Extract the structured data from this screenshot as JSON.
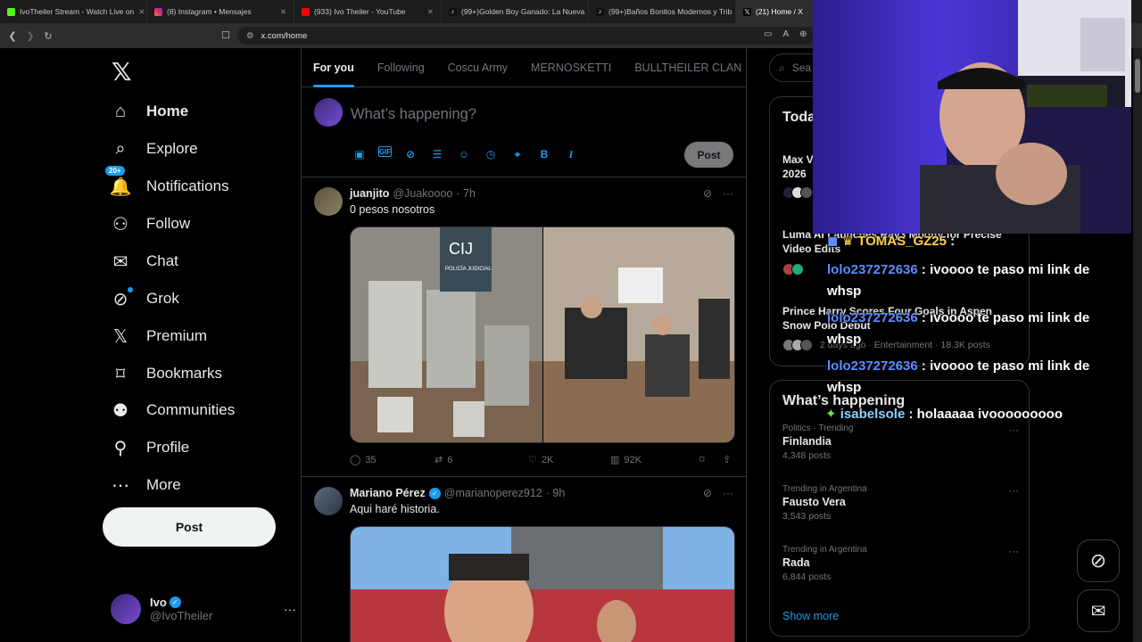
{
  "browser": {
    "tabs": [
      {
        "label": "IvoTheiler Stream - Watch Live on",
        "color": "#53fc18"
      },
      {
        "label": "(8) Instagram • Mensajes",
        "color": "#e1306c"
      },
      {
        "label": "(933) Ivo Theiler - YouTube",
        "color": "#ff0000"
      },
      {
        "label": "(99+)Golden Boy Ganado: La Nueva",
        "color": "#222222"
      },
      {
        "label": "(99+)Baños Bonitos Modernos y Trib",
        "color": "#222222"
      },
      {
        "label": "(21) Home / X",
        "color": "#000000"
      }
    ],
    "url": "x.com/home"
  },
  "sidebar": {
    "items": [
      {
        "label": "Home",
        "icon": "home-icon"
      },
      {
        "label": "Explore",
        "icon": "search-icon"
      },
      {
        "label": "Notifications",
        "icon": "bell-icon",
        "badge": "20+"
      },
      {
        "label": "Follow",
        "icon": "add-user-icon"
      },
      {
        "label": "Chat",
        "icon": "mail-icon"
      },
      {
        "label": "Grok",
        "icon": "grok-icon"
      },
      {
        "label": "Premium",
        "icon": "x-logo-icon"
      },
      {
        "label": "Bookmarks",
        "icon": "bookmark-icon"
      },
      {
        "label": "Communities",
        "icon": "communities-icon"
      },
      {
        "label": "Profile",
        "icon": "profile-icon"
      },
      {
        "label": "More",
        "icon": "more-circle-icon"
      }
    ],
    "post_label": "Post",
    "account": {
      "name": "Ivo",
      "handle": "@IvoTheiler"
    }
  },
  "feed_tabs": [
    "For you",
    "Following",
    "Coscu Army",
    "MERNOSKETTI",
    "BULLTHEILER CLAN"
  ],
  "composer": {
    "placeholder": "What’s happening?",
    "post_label": "Post"
  },
  "tweets": [
    {
      "name": "juanjito",
      "handle": "@Juakoooo",
      "time": "· 7h",
      "text": "0 pesos nosotros",
      "replies": "35",
      "retweets": "6",
      "likes": "2K",
      "views": "92K",
      "media_sign": "CIJ",
      "media_sign_sub": "POLICÍA JUDICIAL"
    },
    {
      "name": "Mariano Pérez",
      "handle": "@marianoperez912",
      "time": "· 9h",
      "text": "Aqui haré historia."
    }
  ],
  "right": {
    "search_placeholder": "Sea",
    "news_title": "Toda",
    "news": [
      {
        "title": "Max V\n2026",
        "meta": ""
      },
      {
        "title": "Luma AI Launches Ray3 Modify for Precise\nVideo Edits",
        "meta": ""
      },
      {
        "title": "Prince Harry Scores Four Goals in Aspen\nSnow Polo Debut",
        "meta": "2 days ago · Entertainment · 18.3K posts"
      }
    ],
    "happening_title": "What’s happening",
    "trends": [
      {
        "context": "Politics · Trending",
        "name": "Finlandia",
        "posts": "4,348 posts"
      },
      {
        "context": "Trending in Argentina",
        "name": "Fausto Vera",
        "posts": "3,543 posts"
      },
      {
        "context": "Trending in Argentina",
        "name": "Rada",
        "posts": "6,844 posts"
      }
    ],
    "show_more": "Show more"
  },
  "chat": [
    {
      "user": "TOMAS_GZ25",
      "msg": ":"
    },
    {
      "user": "lolo237272636",
      "msg": ": ivoooo te paso mi link de whsp"
    },
    {
      "user": "lolo237272636",
      "msg": ": ivoooo te paso mi link de whsp"
    },
    {
      "user": "lolo237272636",
      "msg": ": ivoooo te paso mi link de whsp"
    },
    {
      "user": "isabelsole",
      "msg": ": holaaaaa ivooooooooo"
    }
  ],
  "colors": {
    "accent": "#1d9bf0",
    "bg": "#000000",
    "muted": "#71767b",
    "text": "#e7e9ea"
  }
}
